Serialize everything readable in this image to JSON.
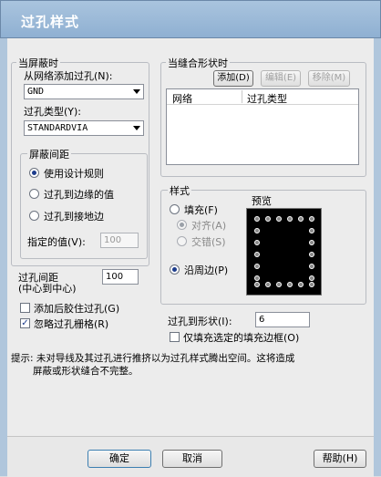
{
  "dialog": {
    "title": "过孔样式"
  },
  "shield": {
    "group_title": "当屏蔽时",
    "add_from_net_label": "从网络添加过孔(N):",
    "net_value": "GND",
    "via_type_label": "过孔类型(Y):",
    "via_type_value": "STANDARDVIA",
    "spacing": {
      "group_title": "屏蔽间距",
      "opt_design_rules": "使用设计规则",
      "opt_via_to_edge": "过孔到边缘的值",
      "opt_via_to_ground": "过孔到接地边",
      "specified_label": "指定的值(V):",
      "specified_value": "100",
      "selected": "opt_design_rules"
    }
  },
  "via_spacing": {
    "label_line1": "过孔间距",
    "label_line2": "(中心到中心)",
    "value": "100"
  },
  "add_after_glue_label": "添加后胶住过孔(G)",
  "ignore_grid_label": "忽略过孔栅格(R)",
  "stitch": {
    "group_title": "当缝合形状时",
    "add_button": "添加(D)",
    "edit_button": "编辑(E)",
    "remove_button": "移除(M)",
    "columns": [
      "网络",
      "过孔类型"
    ]
  },
  "style": {
    "group_title": "样式",
    "fill_label": "填充(F)",
    "align_label": "对齐(A)",
    "stagger_label": "交错(S)",
    "along_edge_label": "沿周边(P)",
    "preview_label": "预览",
    "selected": "along_edge"
  },
  "via_to_shape": {
    "label": "过孔到形状(I):",
    "value": "6"
  },
  "fill_only_selected_label": "仅填充选定的填充边框(O)",
  "hint": {
    "line1": "提示: 未对导线及其过孔进行推挤以为过孔样式腾出空间。这将造成",
    "line2": "屏蔽或形状缝合不完整。"
  },
  "buttons": {
    "ok": "确定",
    "cancel": "取消",
    "help": "帮助(H)"
  },
  "checks": {
    "add_after_glue": false,
    "ignore_grid": true,
    "fill_only_selected": false
  }
}
